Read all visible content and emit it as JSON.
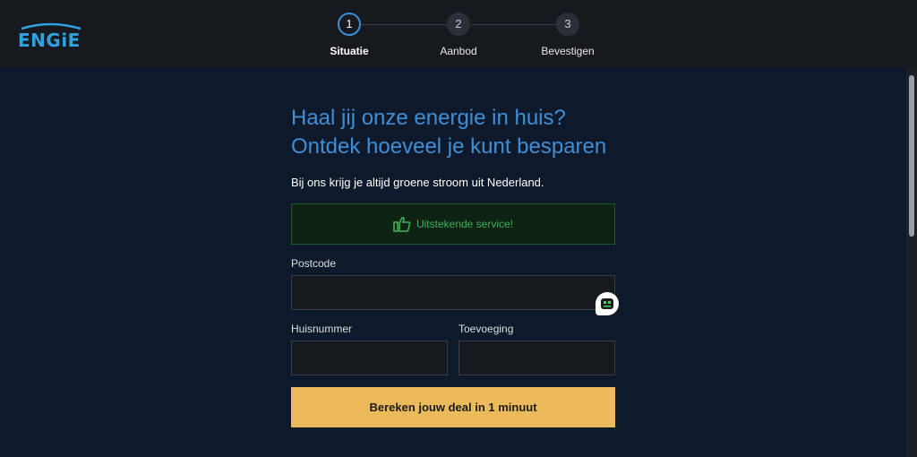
{
  "brand": {
    "logo_text": "ENGiE",
    "color": "#2ea3e0"
  },
  "stepper": {
    "steps": [
      {
        "number": "1",
        "label": "Situatie",
        "active": true
      },
      {
        "number": "2",
        "label": "Aanbod",
        "active": false
      },
      {
        "number": "3",
        "label": "Bevestigen",
        "active": false
      }
    ]
  },
  "main": {
    "headline": "Haal jij onze energie in huis? Ontdek hoeveel je kunt besparen",
    "subline": "Bij ons krijg je altijd groene stroom uit Nederland.",
    "service_badge": {
      "icon": "thumbs-up-icon",
      "text": "Uitstekende service!"
    }
  },
  "form": {
    "postcode_label": "Postcode",
    "postcode_value": "",
    "huisnummer_label": "Huisnummer",
    "huisnummer_value": "",
    "toevoeging_label": "Toevoeging",
    "toevoeging_value": "",
    "submit_label": "Bereken jouw deal in 1 minuut"
  },
  "chat": {
    "icon": "chatbot-icon"
  },
  "colors": {
    "accent_blue": "#3f8ed6",
    "cta_yellow": "#ebba5a",
    "success_green": "#3fb15a",
    "background": "#0e1a2b",
    "topbar": "#16191e"
  }
}
